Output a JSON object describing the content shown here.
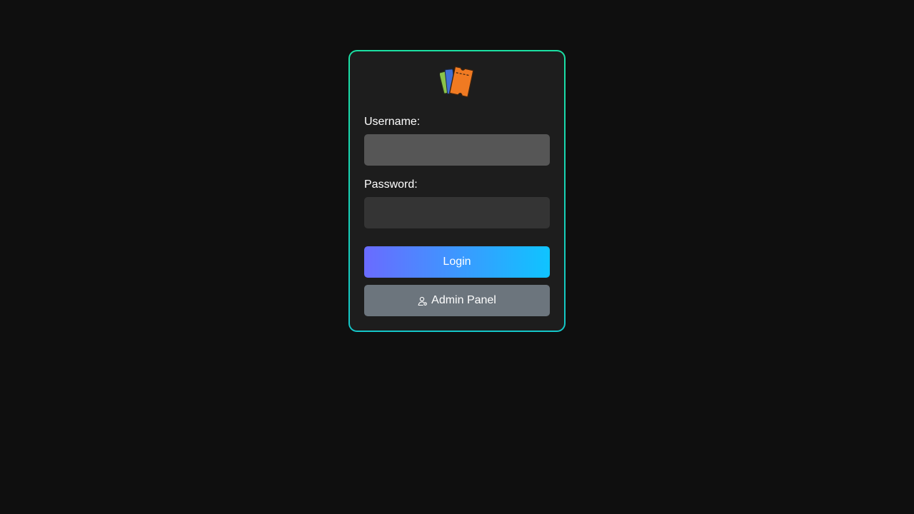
{
  "logo": {
    "icon": "tickets-icon"
  },
  "form": {
    "username_label": "Username:",
    "username_value": "",
    "password_label": "Password:",
    "password_value": ""
  },
  "buttons": {
    "login_label": "Login",
    "admin_label": "Admin Panel",
    "admin_icon": "person-gear-icon"
  },
  "colors": {
    "background": "#0f0f0f",
    "card": "#1d1d1d",
    "card_border": "#1be0a3",
    "login_gradient_start": "#6a6bff",
    "login_gradient_end": "#0fc4ff",
    "admin_button": "#6c757d"
  }
}
